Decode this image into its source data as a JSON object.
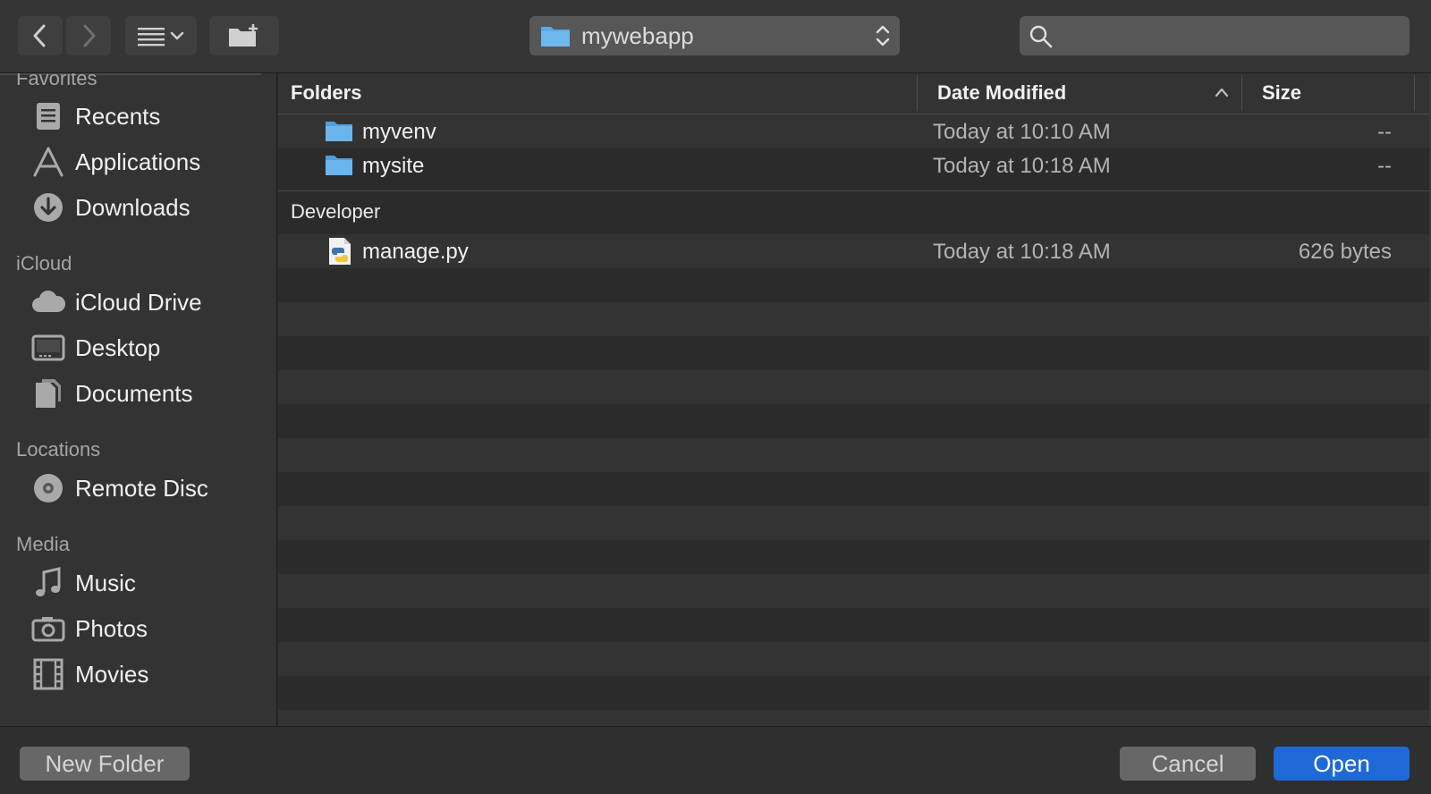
{
  "toolbar": {
    "path_label": "mywebapp",
    "search_placeholder": ""
  },
  "sidebar": {
    "sections": [
      {
        "title": "Favorites",
        "items": [
          {
            "label": "Recents",
            "icon": "recents-icon"
          },
          {
            "label": "Applications",
            "icon": "applications-icon"
          },
          {
            "label": "Downloads",
            "icon": "downloads-icon"
          }
        ]
      },
      {
        "title": "iCloud",
        "items": [
          {
            "label": "iCloud Drive",
            "icon": "cloud-icon"
          },
          {
            "label": "Desktop",
            "icon": "desktop-icon"
          },
          {
            "label": "Documents",
            "icon": "documents-icon"
          }
        ]
      },
      {
        "title": "Locations",
        "items": [
          {
            "label": "Remote Disc",
            "icon": "disc-icon"
          }
        ]
      },
      {
        "title": "Media",
        "items": [
          {
            "label": "Music",
            "icon": "music-icon"
          },
          {
            "label": "Photos",
            "icon": "camera-icon"
          },
          {
            "label": "Movies",
            "icon": "film-icon"
          }
        ]
      }
    ]
  },
  "columns": {
    "name": "Folders",
    "date": "Date Modified",
    "size": "Size"
  },
  "groups": [
    {
      "title": "Folders",
      "rows": [
        {
          "name": "myvenv",
          "date": "Today at 10:10 AM",
          "size": "--",
          "icon": "folder-icon"
        },
        {
          "name": "mysite",
          "date": "Today at 10:18 AM",
          "size": "--",
          "icon": "folder-icon"
        }
      ]
    },
    {
      "title": "Developer",
      "rows": [
        {
          "name": "manage.py",
          "date": "Today at 10:18 AM",
          "size": "626 bytes",
          "icon": "python-file-icon"
        }
      ]
    }
  ],
  "buttons": {
    "new_folder": "New Folder",
    "cancel": "Cancel",
    "open": "Open"
  },
  "colors": {
    "accent": "#1f69d6",
    "folder": "#5aa9e6"
  }
}
